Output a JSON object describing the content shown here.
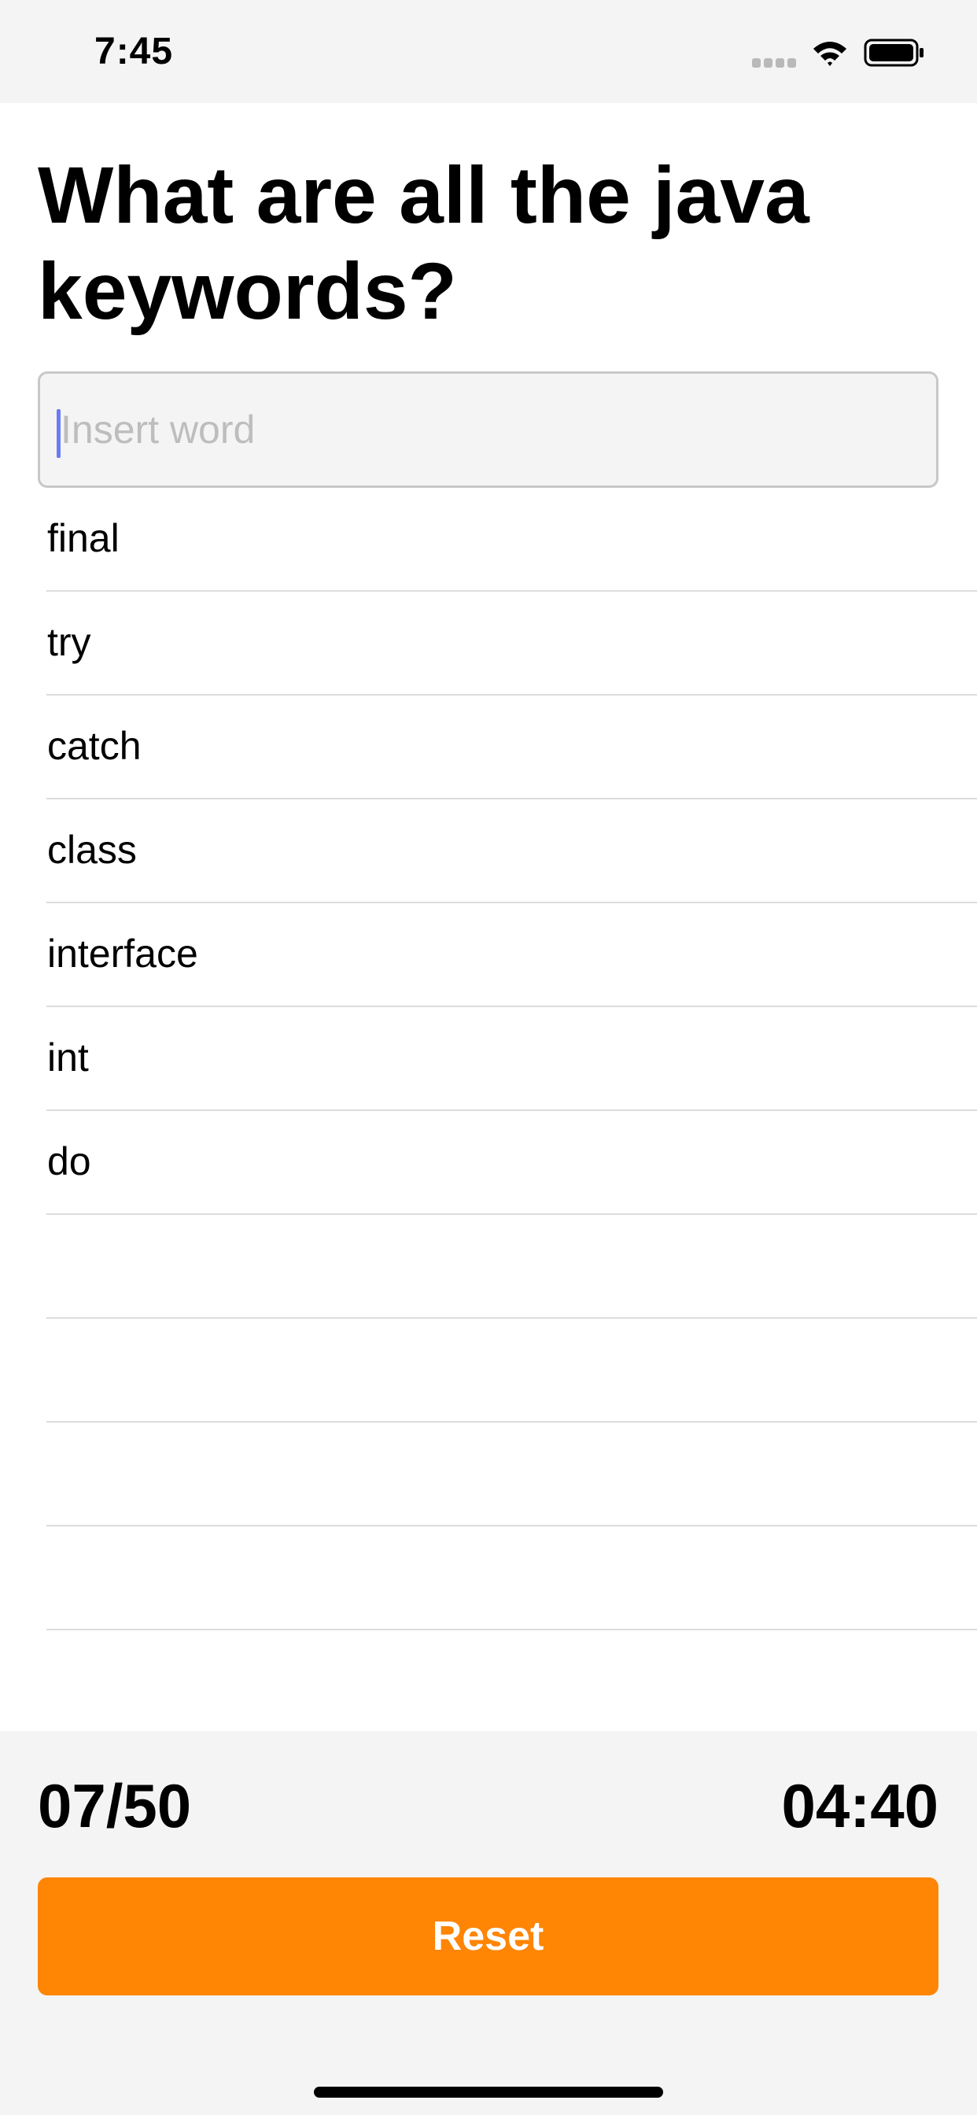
{
  "status_bar": {
    "time": "7:45"
  },
  "quiz": {
    "question": "What are all the java keywords?",
    "input_placeholder": "Insert word",
    "input_value": ""
  },
  "words": [
    "final",
    "try",
    "catch",
    "class",
    "interface",
    "int",
    "do",
    "",
    "",
    "",
    ""
  ],
  "footer": {
    "score": "07/50",
    "timer": "04:40",
    "reset_label": "Reset"
  },
  "colors": {
    "accent": "#ff8505",
    "caret": "#6b7cf2",
    "panel_background": "#f4f4f4"
  }
}
